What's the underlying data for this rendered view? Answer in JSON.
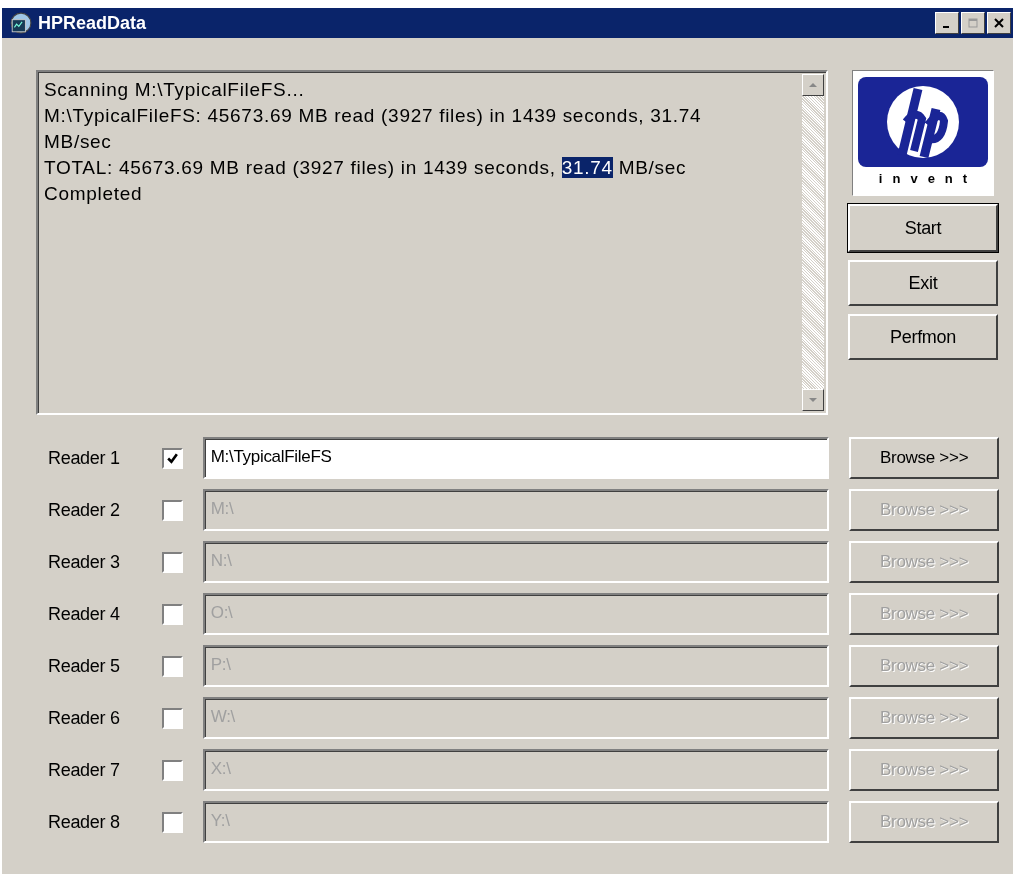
{
  "window": {
    "title": "HPReadData"
  },
  "log": {
    "lines": [
      {
        "segments": [
          {
            "text": "Scanning M:\\TypicalFileFS...",
            "selected": false
          }
        ]
      },
      {
        "segments": [
          {
            "text": "M:\\TypicalFileFS: 45673.69 MB read (3927 files) in 1439 seconds, 31.74",
            "selected": false
          }
        ]
      },
      {
        "segments": [
          {
            "text": "MB/sec",
            "selected": false
          }
        ]
      },
      {
        "segments": [
          {
            "text": "TOTAL: 45673.69 MB read (3927 files) in 1439 seconds, ",
            "selected": false
          },
          {
            "text": "31.74",
            "selected": true
          },
          {
            "text": " MB/sec",
            "selected": false
          }
        ]
      },
      {
        "segments": [
          {
            "text": "Completed",
            "selected": false
          }
        ]
      }
    ]
  },
  "logo": {
    "tagline": "invent"
  },
  "buttons": [
    {
      "label": "Start",
      "default": true
    },
    {
      "label": "Exit",
      "default": false
    },
    {
      "label": "Perfmon",
      "default": false
    }
  ],
  "readers": [
    {
      "label": "Reader 1",
      "checked": true,
      "path": "M:\\TypicalFileFS",
      "browse": "Browse >>>",
      "disabled": false
    },
    {
      "label": "Reader 2",
      "checked": false,
      "path": "M:\\",
      "browse": "Browse >>>",
      "disabled": true
    },
    {
      "label": "Reader 3",
      "checked": false,
      "path": "N:\\",
      "browse": "Browse >>>",
      "disabled": true
    },
    {
      "label": "Reader 4",
      "checked": false,
      "path": "O:\\",
      "browse": "Browse >>>",
      "disabled": true
    },
    {
      "label": "Reader 5",
      "checked": false,
      "path": "P:\\",
      "browse": "Browse >>>",
      "disabled": true
    },
    {
      "label": "Reader 6",
      "checked": false,
      "path": "W:\\",
      "browse": "Browse >>>",
      "disabled": true
    },
    {
      "label": "Reader 7",
      "checked": false,
      "path": "X:\\",
      "browse": "Browse >>>",
      "disabled": true
    },
    {
      "label": "Reader 8",
      "checked": false,
      "path": "Y:\\",
      "browse": "Browse >>>",
      "disabled": true
    }
  ]
}
